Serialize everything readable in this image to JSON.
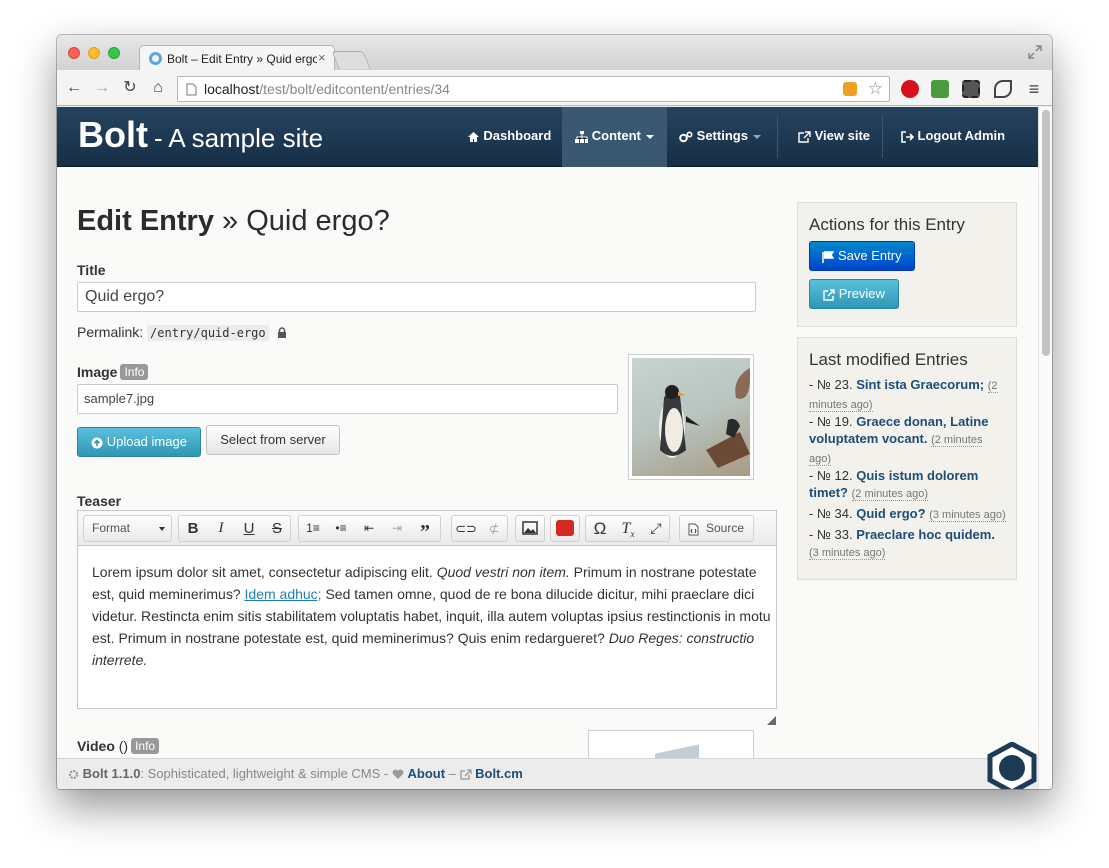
{
  "browser": {
    "tab_title": "Bolt – Edit Entry » Quid ergo?",
    "url_host": "localhost",
    "url_path": "/test/bolt/editcontent/entries/34"
  },
  "navbar": {
    "brand": "Bolt",
    "site_name": "- A sample site",
    "items": [
      {
        "label": "Dashboard",
        "icon": "home-icon"
      },
      {
        "label": "Content",
        "icon": "sitemap-icon",
        "active": true
      },
      {
        "label": "Settings",
        "icon": "gears-icon"
      },
      {
        "label": "View site",
        "icon": "external-link-icon"
      },
      {
        "label": "Logout Admin",
        "icon": "sign-out-icon"
      }
    ]
  },
  "page": {
    "title_bold": "Edit Entry",
    "title_rest": "» Quid ergo?",
    "title_label": "Title",
    "title_value": "Quid ergo?",
    "permalink_label": "Permalink:",
    "permalink_value": "/entry/quid-ergo",
    "image_label": "Image",
    "info_badge": "Info",
    "image_value": "sample7.jpg",
    "upload_button": "Upload image",
    "select_button": "Select from server",
    "teaser_label": "Teaser",
    "video_label": "Video",
    "video_suffix": "()"
  },
  "editor": {
    "format_label": "Format",
    "source_label": "Source",
    "body": {
      "p1": "Lorem ipsum dolor sit amet, consectetur adipiscing elit. ",
      "em1": "Quod vestri non item.",
      "p2": " Primum in nostrane potestate est, quid meminerimus? ",
      "link": "Idem adhuc;",
      "p3": " Sed tamen omne, quod de re bona dilucide dicitur, mihi praeclare dici videtur. Restincta enim sitis stabilitatem voluptatis habet, inquit, illa autem voluptas ipsius restinctionis in motu est. Primum in nostrane potestate est, quid meminerimus? Quis enim redargueret? ",
      "em2": "Duo Reges: constructio interrete."
    }
  },
  "actions_panel": {
    "heading": "Actions for this Entry",
    "save_button": "Save Entry",
    "preview_button": "Preview"
  },
  "last_modified": {
    "heading": "Last modified Entries",
    "entries": [
      {
        "num": "№ 23.",
        "title": "Sint ista Graecorum;",
        "ago": "(2 minutes ago)"
      },
      {
        "num": "№ 19.",
        "title": "Graece donan, Latine voluptatem vocant.",
        "ago": "(2 minutes ago)"
      },
      {
        "num": "№ 12.",
        "title": "Quis istum dolorem timet?",
        "ago": "(2 minutes ago)"
      },
      {
        "num": "№ 34.",
        "title": "Quid ergo?",
        "ago": "(3 minutes ago)"
      },
      {
        "num": "№ 33.",
        "title": "Praeclare hoc quidem.",
        "ago": "(3 minutes ago)"
      }
    ]
  },
  "footer": {
    "version": "Bolt 1.1.0",
    "tagline": ": Sophisticated, lightweight & simple CMS -",
    "about": "About",
    "dash": "–",
    "site": "Bolt.cm"
  },
  "colors": {
    "navbar": "#1f3a55",
    "link": "#1e4d78",
    "primary": "#0055cc",
    "info": "#3aa7cf"
  }
}
